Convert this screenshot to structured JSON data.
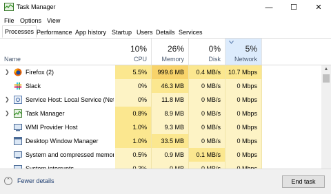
{
  "window": {
    "title": "Task Manager",
    "icon": "task-manager-icon",
    "controls": {
      "minimize": "—",
      "maximize": "☐",
      "close": "✕"
    }
  },
  "menu": [
    "File",
    "Options",
    "View"
  ],
  "tabs": [
    {
      "label": "Processes",
      "active": true
    },
    {
      "label": "Performance",
      "active": false
    },
    {
      "label": "App history",
      "active": false
    },
    {
      "label": "Startup",
      "active": false
    },
    {
      "label": "Users",
      "active": false
    },
    {
      "label": "Details",
      "active": false
    },
    {
      "label": "Services",
      "active": false
    }
  ],
  "columns": {
    "name": {
      "label": "Name"
    },
    "cpu": {
      "percent": "10%",
      "label": "CPU"
    },
    "memory": {
      "percent": "26%",
      "label": "Memory"
    },
    "disk": {
      "percent": "0%",
      "label": "Disk"
    },
    "network": {
      "percent": "5%",
      "label": "Network",
      "sorted": true
    }
  },
  "processes": [
    {
      "name": "Firefox (2)",
      "expandable": true,
      "icon": "firefox-icon",
      "cpu": "5.5%",
      "memory": "999.6 MB",
      "disk": "0.4 MB/s",
      "network": "10.7 Mbps"
    },
    {
      "name": "Slack",
      "expandable": false,
      "icon": "slack-icon",
      "cpu": "0%",
      "memory": "46.3 MB",
      "disk": "0 MB/s",
      "network": "0 Mbps"
    },
    {
      "name": "Service Host: Local Service (Net...",
      "expandable": true,
      "icon": "service-host-icon",
      "cpu": "0%",
      "memory": "11.8 MB",
      "disk": "0 MB/s",
      "network": "0 Mbps"
    },
    {
      "name": "Task Manager",
      "expandable": true,
      "icon": "task-manager-icon",
      "cpu": "0.8%",
      "memory": "8.9 MB",
      "disk": "0 MB/s",
      "network": "0 Mbps"
    },
    {
      "name": "WMI Provider Host",
      "expandable": false,
      "icon": "wmi-icon",
      "cpu": "1.0%",
      "memory": "9.3 MB",
      "disk": "0 MB/s",
      "network": "0 Mbps"
    },
    {
      "name": "Desktop Window Manager",
      "expandable": false,
      "icon": "dwm-icon",
      "cpu": "1.0%",
      "memory": "33.5 MB",
      "disk": "0 MB/s",
      "network": "0 Mbps"
    },
    {
      "name": "System and compressed memory",
      "expandable": false,
      "icon": "system-icon",
      "cpu": "0.5%",
      "memory": "0.9 MB",
      "disk": "0.1 MB/s",
      "network": "0 Mbps"
    },
    {
      "name": "System interrupts",
      "expandable": false,
      "icon": "system-icon",
      "cpu": "0.3%",
      "memory": "0 MB",
      "disk": "0 MB/s",
      "network": "0 Mbps"
    }
  ],
  "footer": {
    "fewer_details": "Fewer details",
    "end_task": "End task"
  },
  "colors": {
    "highlight_strong": "#fbe78f",
    "highlight_light": "#fdf3c5",
    "sorted_header": "#dcebfc"
  }
}
